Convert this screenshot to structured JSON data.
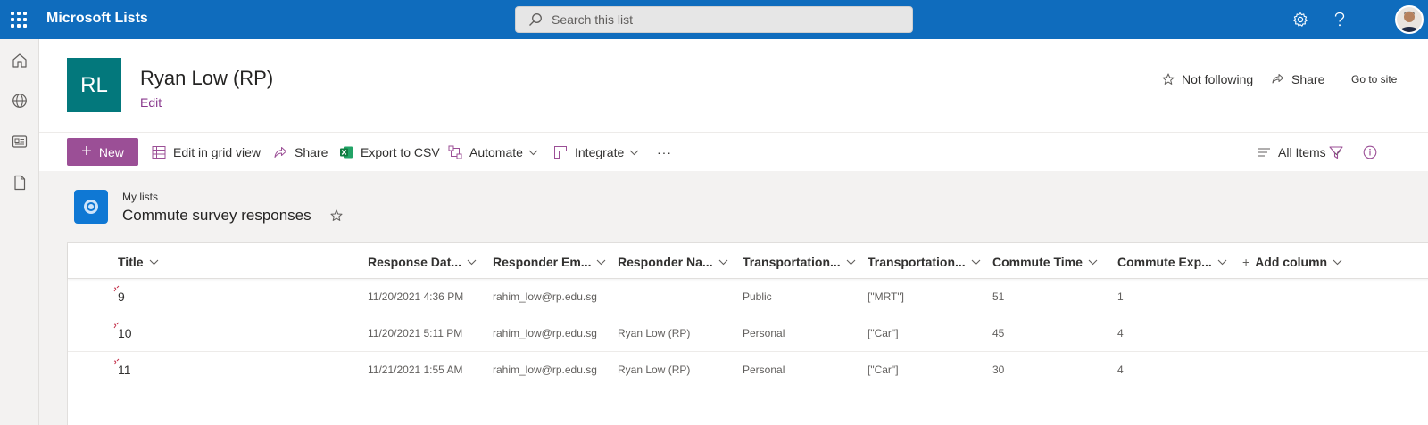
{
  "app": {
    "title": "Microsoft Lists"
  },
  "search": {
    "placeholder": "Search this list"
  },
  "site": {
    "logo_initials": "RL",
    "title": "Ryan Low (RP)",
    "edit_label": "Edit",
    "follow_label": "Not following",
    "share_label": "Share",
    "goto_label": "Go to site"
  },
  "toolbar": {
    "new_label": "New",
    "grid_label": "Edit in grid view",
    "share_label": "Share",
    "export_label": "Export to CSV",
    "automate_label": "Automate",
    "integrate_label": "Integrate",
    "more_label": "···",
    "view_label": "All Items"
  },
  "list": {
    "breadcrumb": "My lists",
    "title": "Commute survey responses"
  },
  "table": {
    "columns": [
      "Title",
      "Response Dat...",
      "Responder Em...",
      "Responder Na...",
      "Transportation...",
      "Transportation...",
      "Commute Time",
      "Commute Exp...",
      "Add column"
    ],
    "rows": [
      {
        "title": "9",
        "date": "11/20/2021 4:36 PM",
        "email": "rahim_low@rp.edu.sg",
        "name": "",
        "mode": "Public",
        "transport": "[\"MRT\"]",
        "time": "51",
        "exp": "1"
      },
      {
        "title": "10",
        "date": "11/20/2021 5:11 PM",
        "email": "rahim_low@rp.edu.sg",
        "name": "Ryan Low (RP)",
        "mode": "Personal",
        "transport": "[\"Car\"]",
        "time": "45",
        "exp": "4"
      },
      {
        "title": "11",
        "date": "11/21/2021 1:55 AM",
        "email": "rahim_low@rp.edu.sg",
        "name": "Ryan Low (RP)",
        "mode": "Personal",
        "transport": "[\"Car\"]",
        "time": "30",
        "exp": "4"
      }
    ]
  },
  "colors": {
    "brand": "#0f6cbd",
    "accent": "#9b4f96",
    "site_logo": "#03787c",
    "list_icon": "#0f78d4",
    "new_item_marker": "#c4314b"
  },
  "icons": {
    "waffle": "app-launcher-icon",
    "settings": "gear-icon",
    "help": "question-icon",
    "rail": [
      "home-icon",
      "globe-icon",
      "news-icon",
      "document-icon"
    ]
  }
}
